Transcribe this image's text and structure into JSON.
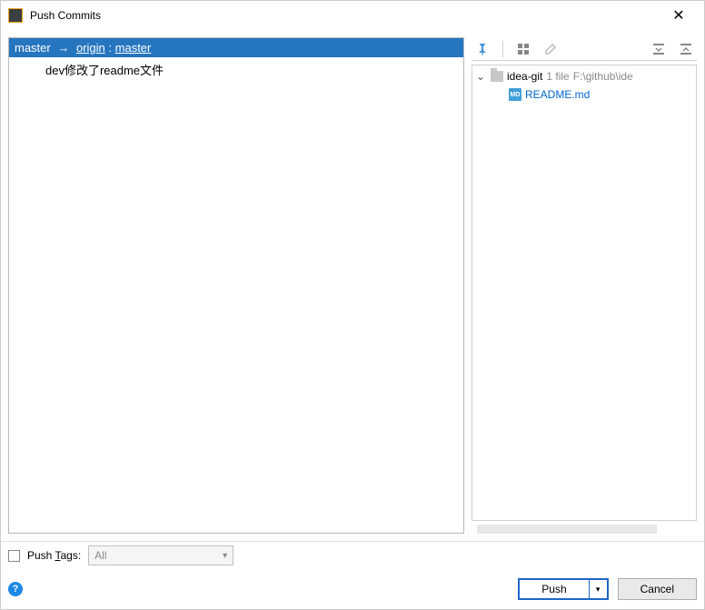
{
  "window": {
    "title": "Push Commits"
  },
  "branchHeader": {
    "local": "master",
    "remote": "origin",
    "remoteBranch": "master"
  },
  "commits": [
    {
      "message": "dev修改了readme文件"
    }
  ],
  "fileTree": {
    "project": "idea-git",
    "fileCountLabel": "1 file",
    "path": "F:\\github\\ide",
    "files": [
      {
        "name": "README.md",
        "iconText": "MD"
      }
    ]
  },
  "options": {
    "pushTagsLabelPre": "Push ",
    "pushTagsMnemonic": "T",
    "pushTagsLabelPost": "ags:",
    "tagsComboValue": "All"
  },
  "buttons": {
    "push": "Push",
    "cancel": "Cancel"
  }
}
